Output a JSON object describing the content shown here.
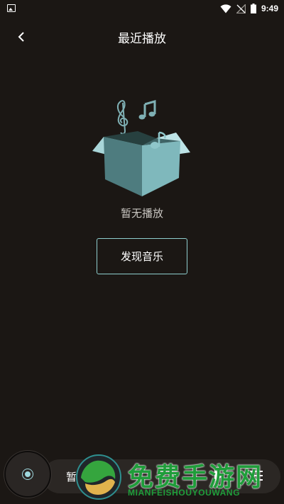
{
  "status_bar": {
    "time": "9:49"
  },
  "header": {
    "title": "最近播放"
  },
  "empty_state": {
    "message": "暂无播放",
    "button_label": "发现音乐"
  },
  "mini_player": {
    "track_label": "暂无歌曲"
  },
  "watermark": {
    "title": "免费手游网",
    "subtitle": "MIANFEISHOUYOUWANG"
  },
  "colors": {
    "background": "#1b1714",
    "accent": "#8fcfcf",
    "watermark": "#1f9d3a"
  }
}
